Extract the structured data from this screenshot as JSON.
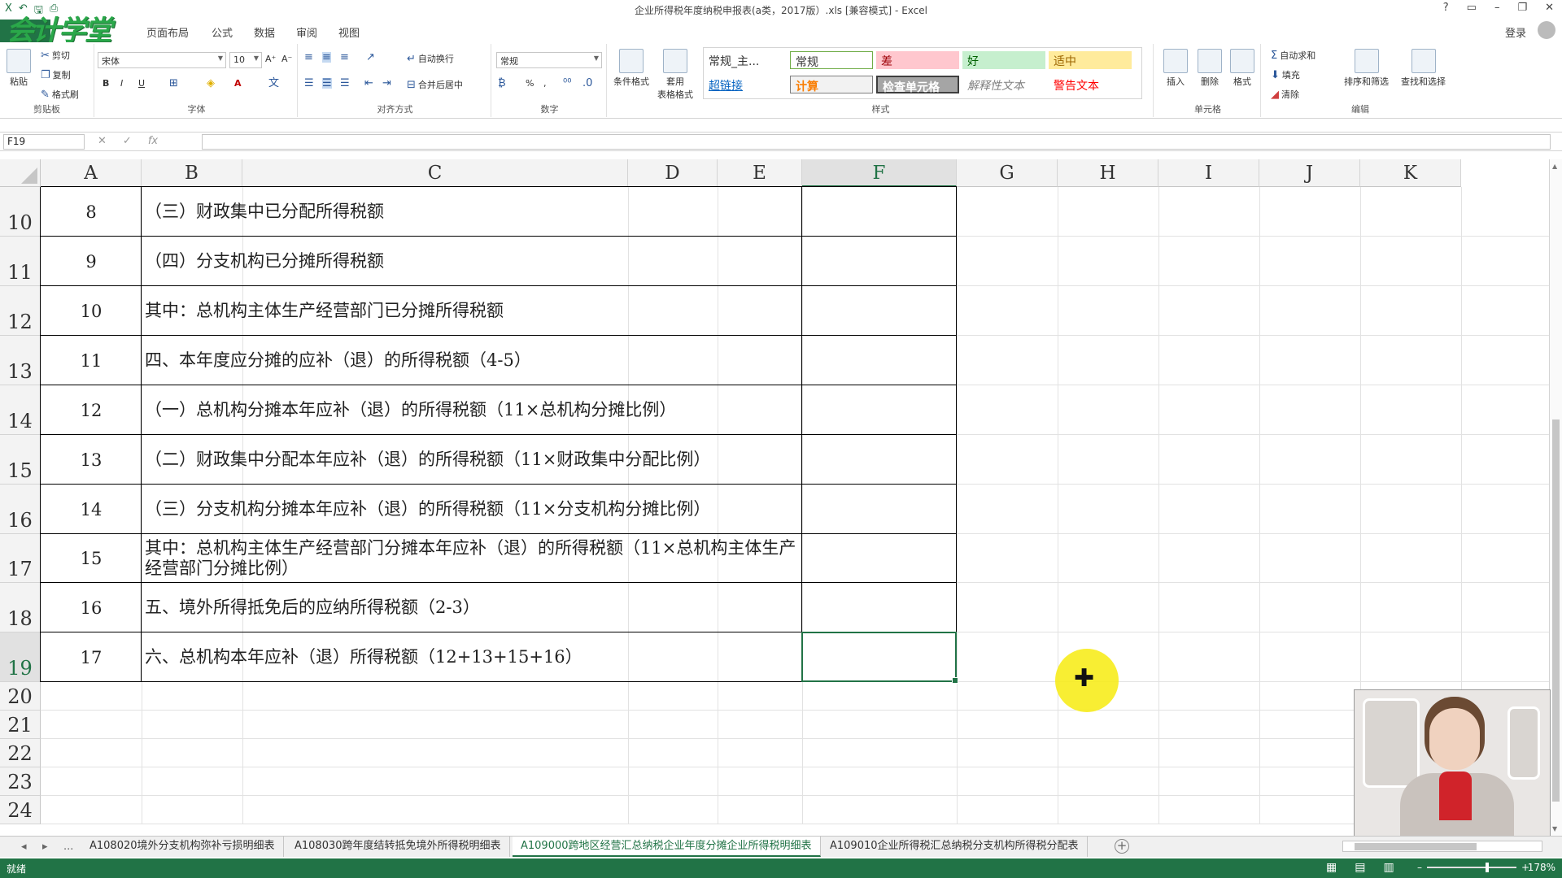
{
  "window": {
    "title": "企业所得税年度纳税申报表(a类，2017版）.xls  [兼容模式] - Excel",
    "controls": [
      "?",
      "▭",
      "–",
      "❐",
      "✕"
    ],
    "login": "登录"
  },
  "ribbon_tabs": [
    "页面布局",
    "公式",
    "数据",
    "审阅",
    "视图"
  ],
  "logo_text": "会计学堂",
  "ribbon": {
    "clipboard": {
      "paste": "粘贴",
      "cut": "剪切",
      "copy": "复制",
      "format_painter": "格式刷",
      "label": "剪贴板"
    },
    "font": {
      "name": "宋体",
      "size": "10",
      "bold": "B",
      "italic": "I",
      "underline": "U",
      "label": "字体"
    },
    "alignment": {
      "wrap": "自动换行",
      "merge": "合并后居中",
      "label": "对齐方式"
    },
    "number": {
      "format": "常规",
      "percent": "%",
      "comma": ",",
      "label": "数字"
    },
    "styles": {
      "conditional": "条件格式",
      "table": "套用\n表格格式",
      "cells": [
        {
          "text": "常规_主...",
          "bg": "#ffffff",
          "color": "#000000"
        },
        {
          "text": "常规",
          "bg": "#ffffff",
          "color": "#000000"
        },
        {
          "text": "差",
          "bg": "#ffc7ce",
          "color": "#9c0006"
        },
        {
          "text": "好",
          "bg": "#c6efce",
          "color": "#006100"
        },
        {
          "text": "适中",
          "bg": "#ffeb9c",
          "color": "#9c6500"
        },
        {
          "text": "超链接",
          "bg": "#ffffff",
          "color": "#0563c1"
        },
        {
          "text": "计算",
          "bg": "#f2f2f2",
          "color": "#fa7d00"
        },
        {
          "text": "检查单元格",
          "bg": "#a5a5a5",
          "color": "#ffffff"
        },
        {
          "text": "解释性文本",
          "bg": "#ffffff",
          "color": "#7f7f7f"
        },
        {
          "text": "警告文本",
          "bg": "#ffffff",
          "color": "#ff0000"
        }
      ],
      "label": "样式"
    },
    "cells_group": {
      "insert": "插入",
      "delete": "删除",
      "format": "格式",
      "label": "单元格"
    },
    "editing": {
      "autosum": "自动求和",
      "fill": "填充",
      "clear": "清除",
      "sort": "排序和筛选",
      "find": "查找和选择",
      "label": "编辑"
    }
  },
  "formula_bar": {
    "name_box": "F19",
    "cancel": "✕",
    "enter": "✓",
    "fx": "fx",
    "content": ""
  },
  "columns": [
    "A",
    "B",
    "C",
    "D",
    "E",
    "F",
    "G",
    "H",
    "I",
    "J",
    "K"
  ],
  "selected_column": "F",
  "selected_row": "19",
  "rows": [
    {
      "row": "10",
      "num": "8",
      "text": "（三）财政集中已分配所得税额"
    },
    {
      "row": "11",
      "num": "9",
      "text": "（四）分支机构已分摊所得税额"
    },
    {
      "row": "12",
      "num": "10",
      "text": "其中：总机构主体生产经营部门已分摊所得税额"
    },
    {
      "row": "13",
      "num": "11",
      "text": "四、本年度应分摊的应补（退）的所得税额（4-5）"
    },
    {
      "row": "14",
      "num": "12",
      "text": "（一）总机构分摊本年应补（退）的所得税额（11×总机构分摊比例）"
    },
    {
      "row": "15",
      "num": "13",
      "text": "（二）财政集中分配本年应补（退）的所得税额（11×财政集中分配比例）"
    },
    {
      "row": "16",
      "num": "14",
      "text": "（三）分支机构分摊本年应补（退）的所得税额（11×分支机构分摊比例）"
    },
    {
      "row": "17",
      "num": "15",
      "text": "其中：总机构主体生产经营部门分摊本年应补（退）的所得税额（11×总机构主体生产经营部门分摊比例）"
    },
    {
      "row": "18",
      "num": "16",
      "text": "五、境外所得抵免后的应纳所得税额（2-3）"
    },
    {
      "row": "19",
      "num": "17",
      "text": "六、总机构本年应补（退）所得税额（12+13+15+16）"
    }
  ],
  "empty_rows": [
    "20",
    "21",
    "22",
    "23",
    "24"
  ],
  "sheet_tabs": [
    "A108020境外分支机构弥补亏损明细表",
    "A108030跨年度结转抵免境外所得税明细表",
    "A109000跨地区经营汇总纳税企业年度分摊企业所得税明细表",
    "A109010企业所得税汇总纳税分支机构所得税分配表"
  ],
  "active_sheet_index": 2,
  "sheet_nav": {
    "prev": "◂",
    "next": "▸",
    "more": "...",
    "add": "+"
  },
  "status": {
    "ready": "就绪",
    "zoom": "178%",
    "zoom_minus": "–",
    "zoom_plus": "+"
  }
}
